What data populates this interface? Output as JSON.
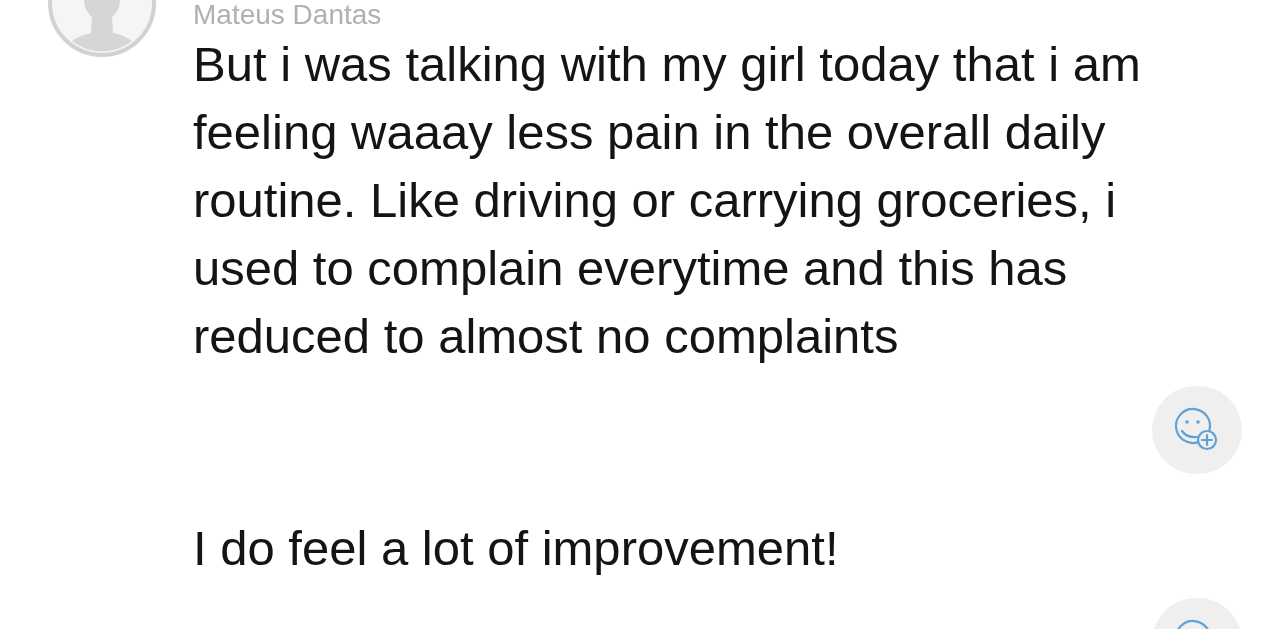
{
  "messages": [
    {
      "avatar": true,
      "author": "Mateus Dantas",
      "text": "But i was talking with my girl today that i am feeling waaay less pain in the overall daily routine. Like driving or carrying groceries, i used to complain everytime and this has reduced to almost no complaints",
      "reaction_button": true
    },
    {
      "text": "I do feel a lot of improvement!",
      "reaction_button": true
    }
  ]
}
